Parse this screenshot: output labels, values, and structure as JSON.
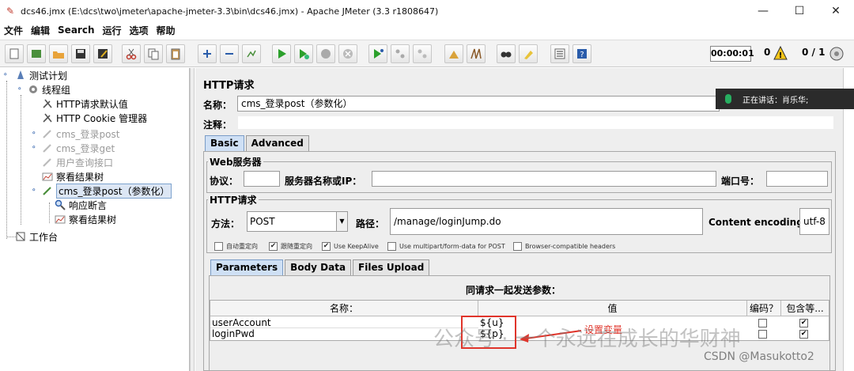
{
  "window": {
    "title": "dcs46.jmx (E:\\dcs\\two\\jmeter\\apache-jmeter-3.3\\bin\\dcs46.jmx) - Apache JMeter (3.3 r1808647)",
    "minimize": "—",
    "maximize": "☐",
    "close": "✕"
  },
  "menu": [
    "文件",
    "编辑",
    "Search",
    "运行",
    "选项",
    "帮助"
  ],
  "toolbar": {
    "timer": "00:00:01",
    "warn_count": "0",
    "threads": "0 / 1"
  },
  "tree": [
    {
      "label": "测试计划",
      "icon": "test-plan-icon",
      "disabled": false,
      "selected": false
    },
    {
      "label": "线程组",
      "icon": "gear-icon",
      "disabled": false,
      "selected": false
    },
    {
      "label": "HTTP请求默认值",
      "icon": "wrench-icon",
      "disabled": false,
      "selected": false
    },
    {
      "label": "HTTP Cookie 管理器",
      "icon": "wrench-icon",
      "disabled": false,
      "selected": false
    },
    {
      "label": "cms_登录post",
      "icon": "pencil-icon",
      "disabled": true,
      "selected": false
    },
    {
      "label": "cms_登录get",
      "icon": "pencil-icon",
      "disabled": true,
      "selected": false
    },
    {
      "label": "用户查询接口",
      "icon": "pencil-icon",
      "disabled": true,
      "selected": false
    },
    {
      "label": "察看结果树",
      "icon": "chart-icon",
      "disabled": false,
      "selected": false
    },
    {
      "label": "cms_登录post（参数化）",
      "icon": "pencil-icon",
      "disabled": false,
      "selected": true
    },
    {
      "label": "响应断言",
      "icon": "magnifier-icon",
      "disabled": false,
      "selected": false
    },
    {
      "label": "察看结果树",
      "icon": "chart-icon",
      "disabled": false,
      "selected": false
    },
    {
      "label": "工作台",
      "icon": "workbench-icon",
      "disabled": false,
      "selected": false
    }
  ],
  "panel": {
    "title": "HTTP请求",
    "name_label": "名称：",
    "name_value": "cms_登录post（参数化）",
    "comment_label": "注释：",
    "tabs": [
      "Basic",
      "Advanced"
    ],
    "web_server_legend": "Web服务器",
    "protocol_label": "协议：",
    "server_label": "服务器名称或IP：",
    "port_label": "端口号：",
    "http_request_legend": "HTTP请求",
    "method_label": "方法：",
    "method_value": "POST",
    "path_label": "路径：",
    "path_value": "/manage/loginJump.do",
    "encoding_label": "Content encoding:",
    "encoding_value": "utf-8",
    "checkboxes": [
      {
        "label": "自动重定向",
        "checked": false
      },
      {
        "label": "跟随重定向",
        "checked": true
      },
      {
        "label": "Use KeepAlive",
        "checked": true
      },
      {
        "label": "Use multipart/form-data for POST",
        "checked": false
      },
      {
        "label": "Browser-compatible headers",
        "checked": false
      }
    ],
    "param_tabs": [
      "Parameters",
      "Body Data",
      "Files Upload"
    ],
    "params_title": "同请求一起发送参数：",
    "table_headers": [
      "名称：",
      "值",
      "编码？",
      "包含等..."
    ],
    "params": [
      {
        "name": "userAccount",
        "value": "${u}"
      },
      {
        "name": "loginPwd",
        "value": "${p}"
      }
    ]
  },
  "overlay": {
    "speaking": "正在讲话：肖乐华;",
    "annotation": "设置变量",
    "watermark": "公众号 · 一个永远在成长的华财神",
    "csdn": "CSDN @Masukotto2"
  }
}
